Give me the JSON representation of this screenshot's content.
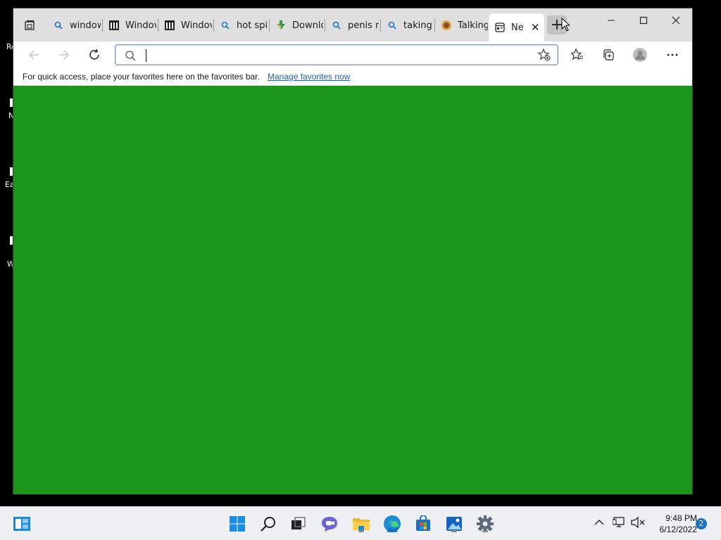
{
  "desktop": {
    "icon_labels": [
      "Re",
      "N",
      "Ea",
      "W"
    ]
  },
  "browser": {
    "tabs": [
      {
        "title": "window",
        "icon": "search-icon"
      },
      {
        "title": "Windov",
        "icon": "museum-icon"
      },
      {
        "title": "Windov",
        "icon": "museum-icon"
      },
      {
        "title": "hot spic",
        "icon": "search-icon"
      },
      {
        "title": "Downlo",
        "icon": "download-icon"
      },
      {
        "title": "penis m",
        "icon": "search-icon"
      },
      {
        "title": "taking l",
        "icon": "search-icon"
      },
      {
        "title": "Talking",
        "icon": "site-icon"
      },
      {
        "title": "Ne",
        "icon": "newtab-icon",
        "active": true
      }
    ],
    "new_tab_label": "+",
    "address": {
      "value": "",
      "placeholder": ""
    },
    "favorites_bar": {
      "message": "For quick access, place your favorites here on the favorites bar.",
      "link": "Manage favorites now"
    },
    "page_color": "#1a961a"
  },
  "taskbar": {
    "time": "9:48 PM",
    "date": "6/12/2022",
    "notification_count": "2",
    "accent": "#1a73c8"
  }
}
